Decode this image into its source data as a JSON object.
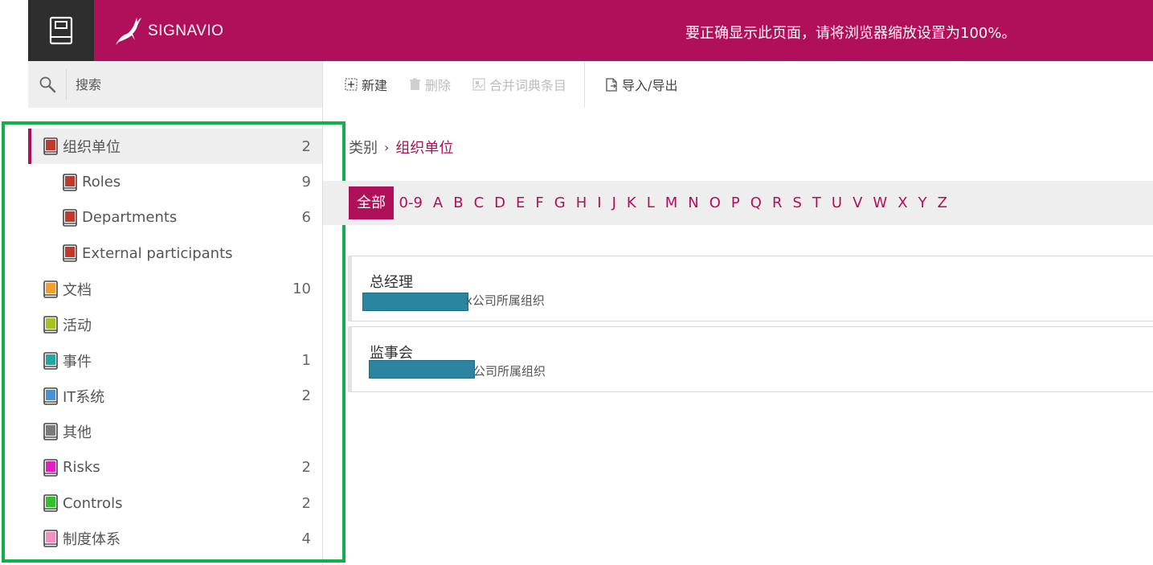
{
  "header": {
    "logo_text": "SIGNAVIO",
    "message": "要正确显示此页面，请将浏览器缩放设置为100%。",
    "brand_color": "#b0105a"
  },
  "search": {
    "placeholder": "搜索"
  },
  "toolbar": {
    "new_label": "新建",
    "delete_label": "删除",
    "merge_label": "合并词典条目",
    "import_export_label": "导入/导出"
  },
  "breadcrumb": {
    "root": "类别",
    "separator": "›",
    "current": "组织单位"
  },
  "alphabet": [
    "全部",
    "0-9",
    "A",
    "B",
    "C",
    "D",
    "E",
    "F",
    "G",
    "H",
    "I",
    "J",
    "K",
    "L",
    "M",
    "N",
    "O",
    "P",
    "Q",
    "R",
    "S",
    "T",
    "U",
    "V",
    "W",
    "X",
    "Y",
    "Z"
  ],
  "sidebar": {
    "items": [
      {
        "label": "组织单位",
        "count": "2",
        "level": 0,
        "color": "#c0392b",
        "active": true
      },
      {
        "label": "Roles",
        "count": "9",
        "level": 1,
        "color": "#c0392b"
      },
      {
        "label": "Departments",
        "count": "6",
        "level": 1,
        "color": "#c0392b"
      },
      {
        "label": "External participants",
        "count": "",
        "level": 1,
        "color": "#c0392b"
      },
      {
        "label": "文档",
        "count": "10",
        "level": 0,
        "color": "#f0a030"
      },
      {
        "label": "活动",
        "count": "",
        "level": 0,
        "color": "#a8c020"
      },
      {
        "label": "事件",
        "count": "1",
        "level": 0,
        "color": "#20a8a8"
      },
      {
        "label": "IT系统",
        "count": "2",
        "level": 0,
        "color": "#4a90d9"
      },
      {
        "label": "其他",
        "count": "",
        "level": 0,
        "color": "#7a7a7a"
      },
      {
        "label": "Risks",
        "count": "2",
        "level": 0,
        "color": "#e020c0"
      },
      {
        "label": "Controls",
        "count": "2",
        "level": 0,
        "color": "#30c030"
      },
      {
        "label": "制度体系",
        "count": "4",
        "level": 0,
        "color": "#f090c0"
      }
    ]
  },
  "entries": [
    {
      "title": "总经理",
      "subtitle_visible": "x公司所属组织"
    },
    {
      "title": "监事会",
      "subtitle_visible": "公司所属组织"
    }
  ]
}
